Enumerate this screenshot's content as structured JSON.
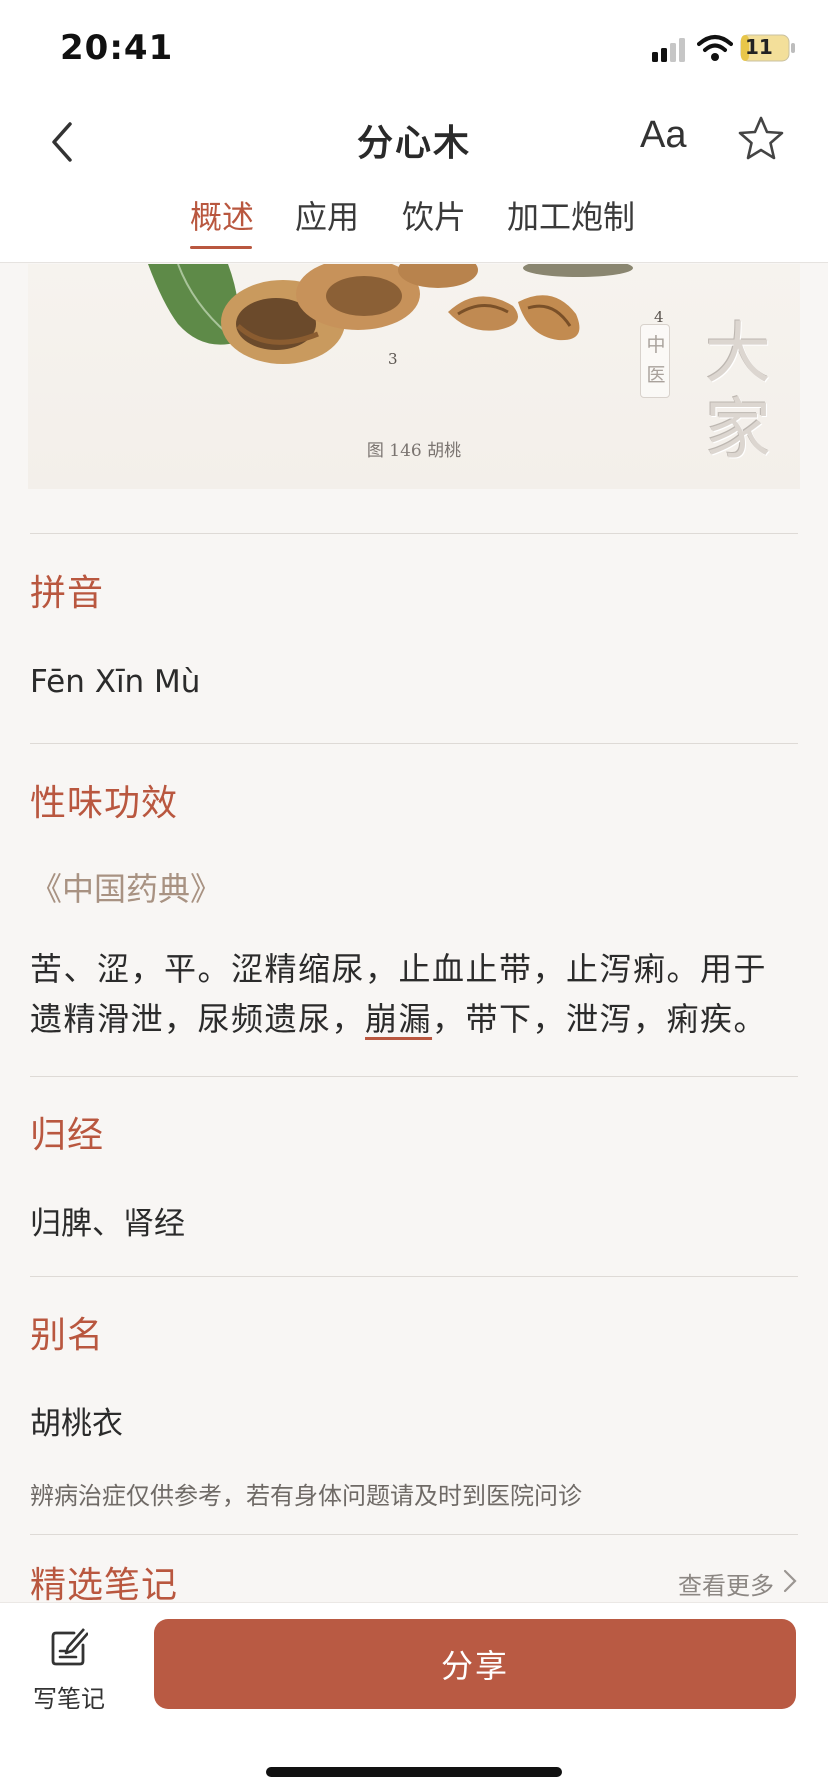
{
  "status_bar": {
    "time": "20:41",
    "battery": "11"
  },
  "header": {
    "title": "分心木",
    "font_size_label": "Aa",
    "tabs": [
      {
        "label": "概述",
        "active": true
      },
      {
        "label": "应用",
        "active": false
      },
      {
        "label": "饮片",
        "active": false
      },
      {
        "label": "加工炮制",
        "active": false
      }
    ]
  },
  "image": {
    "caption": "图 146 胡桃",
    "figure_numbers": [
      "3",
      "4"
    ],
    "watermark_small": "中医",
    "watermark_big": "大家"
  },
  "sections": {
    "pinyin": {
      "title": "拼音",
      "text": "Fēn Xīn Mù"
    },
    "properties": {
      "title": "性味功效",
      "source": "《中国药典》",
      "text_before": "苦、涩，平。涩精缩尿，止血止带，止泻痢。用于遗精滑泄，尿频遗尿，",
      "underlined_term": "崩漏",
      "text_after": "，带下，泄泻，痢疾。"
    },
    "meridian": {
      "title": "归经",
      "text": "归脾、肾经"
    },
    "alias": {
      "title": "别名",
      "text": "胡桃衣"
    }
  },
  "disclaimer": "辨病治症仅供参考，若有身体问题请及时到医院问诊",
  "notes": {
    "title": "精选笔记",
    "view_more": "查看更多"
  },
  "bottom_bar": {
    "write_note_label": "写笔记",
    "share_label": "分享"
  },
  "colors": {
    "accent": "#b9573f",
    "share_button": "#b95a43",
    "background": "#f8f6f4",
    "source_text": "#a89282"
  },
  "icons": [
    "back-icon",
    "star-icon",
    "signal-icon",
    "wifi-icon",
    "battery-icon",
    "chevron-right-icon",
    "note-edit-icon"
  ]
}
